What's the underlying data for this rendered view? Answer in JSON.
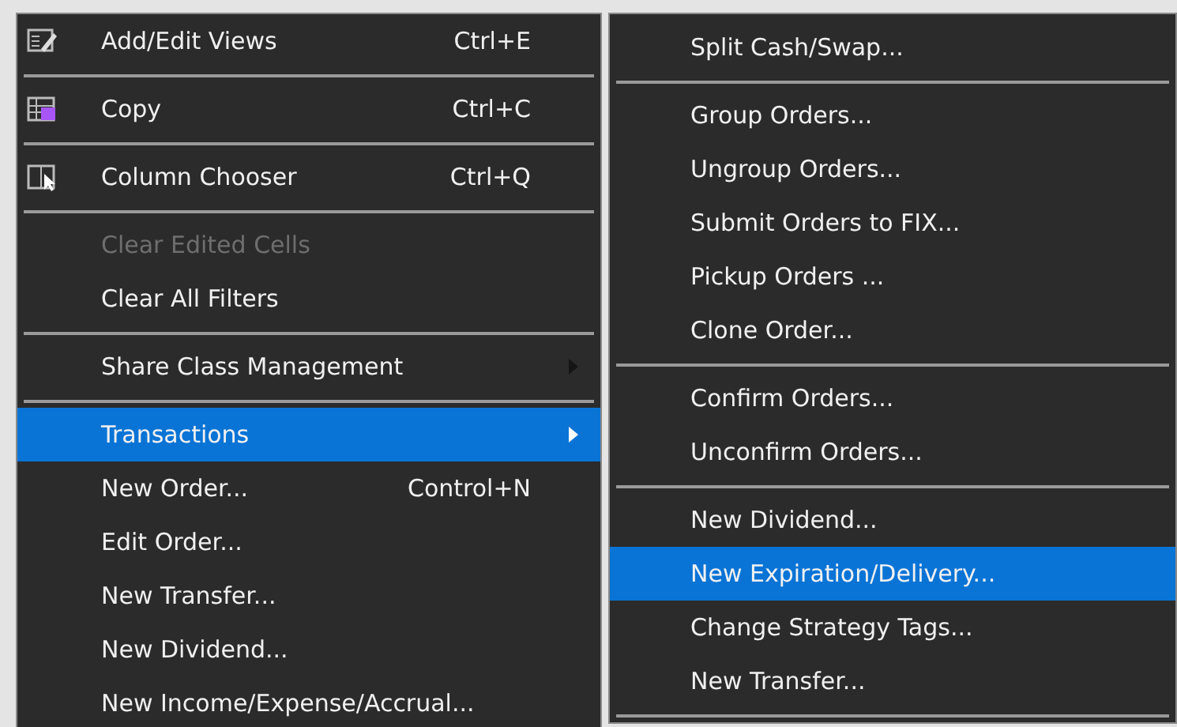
{
  "context_menu": {
    "items": [
      {
        "kind": "item",
        "label": "Add/Edit Views",
        "shortcut": "Ctrl+E",
        "selected": false,
        "disabled": false
      },
      {
        "kind": "separator"
      },
      {
        "kind": "item",
        "label": "Copy",
        "shortcut": "Ctrl+C",
        "selected": false,
        "disabled": false
      },
      {
        "kind": "separator"
      },
      {
        "kind": "item",
        "label": "Column Chooser",
        "shortcut": "Ctrl+Q",
        "selected": false,
        "disabled": false
      },
      {
        "kind": "separator"
      },
      {
        "kind": "item",
        "label": "Clear Edited Cells",
        "selected": false,
        "disabled": true
      },
      {
        "kind": "item",
        "label": "Clear All Filters",
        "selected": false,
        "disabled": false
      },
      {
        "kind": "separator"
      },
      {
        "kind": "item",
        "label": "Share Class Management",
        "submenu": true,
        "selected": false,
        "disabled": false
      },
      {
        "kind": "separator"
      },
      {
        "kind": "item",
        "label": "Transactions",
        "submenu": true,
        "selected": true,
        "disabled": false
      },
      {
        "kind": "item",
        "label": "New Order...",
        "shortcut": "Control+N",
        "selected": false,
        "disabled": false
      },
      {
        "kind": "item",
        "label": "Edit Order...",
        "selected": false,
        "disabled": false
      },
      {
        "kind": "item",
        "label": "New Transfer...",
        "selected": false,
        "disabled": false
      },
      {
        "kind": "item",
        "label": "New Dividend...",
        "selected": false,
        "disabled": false
      },
      {
        "kind": "item",
        "label": "New Income/Expense/Accrual...",
        "selected": false,
        "disabled": false
      }
    ]
  },
  "submenu": {
    "items": [
      {
        "kind": "item",
        "label": "Split Cash/Swap...",
        "selected": false
      },
      {
        "kind": "separator"
      },
      {
        "kind": "item",
        "label": "Group Orders...",
        "selected": false
      },
      {
        "kind": "item",
        "label": "Ungroup Orders...",
        "selected": false
      },
      {
        "kind": "item",
        "label": "Submit Orders to FIX...",
        "selected": false
      },
      {
        "kind": "item",
        "label": "Pickup Orders ...",
        "selected": false
      },
      {
        "kind": "item",
        "label": "Clone Order...",
        "selected": false
      },
      {
        "kind": "separator"
      },
      {
        "kind": "item",
        "label": "Confirm Orders...",
        "selected": false
      },
      {
        "kind": "item",
        "label": "Unconfirm Orders...",
        "selected": false
      },
      {
        "kind": "separator"
      },
      {
        "kind": "item",
        "label": "New Dividend...",
        "selected": false
      },
      {
        "kind": "item",
        "label": "New Expiration/Delivery...",
        "selected": true
      },
      {
        "kind": "item",
        "label": "Change Strategy Tags...",
        "selected": false
      },
      {
        "kind": "item",
        "label": "New Transfer...",
        "selected": false
      },
      {
        "kind": "separator"
      }
    ]
  }
}
